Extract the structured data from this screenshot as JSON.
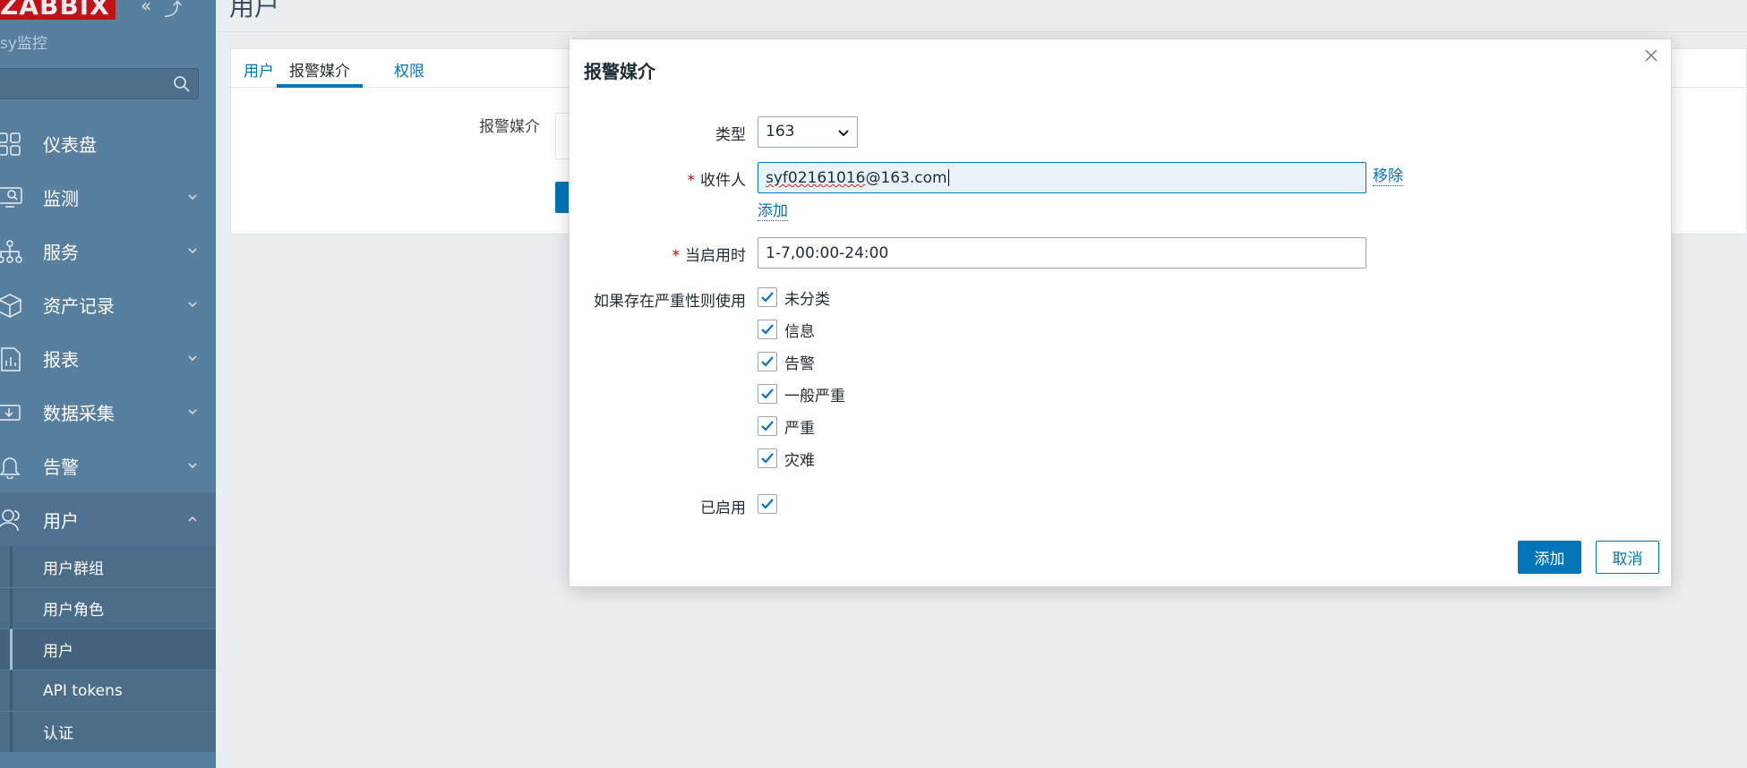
{
  "sidebar": {
    "logo": "ZABBIX",
    "brand_sub": "sy监控",
    "nav": [
      {
        "label": "仪表盘",
        "icon": "dashboard-icon"
      },
      {
        "label": "监测",
        "icon": "monitoring-icon"
      },
      {
        "label": "服务",
        "icon": "services-icon"
      },
      {
        "label": "资产记录",
        "icon": "inventory-icon"
      },
      {
        "label": "报表",
        "icon": "reports-icon"
      },
      {
        "label": "数据采集",
        "icon": "data-collection-icon"
      },
      {
        "label": "告警",
        "icon": "alerts-icon"
      },
      {
        "label": "用户",
        "icon": "users-icon"
      }
    ],
    "subnav": [
      {
        "label": "用户群组"
      },
      {
        "label": "用户角色"
      },
      {
        "label": "用户"
      },
      {
        "label": "API tokens"
      },
      {
        "label": "认证"
      }
    ]
  },
  "page": {
    "title": "用户",
    "tabs": [
      "用户",
      "报警媒介",
      "权限"
    ],
    "media_label": "报警媒介"
  },
  "modal": {
    "title": "报警媒介",
    "type_label": "类型",
    "type_value": "163",
    "sendto_label": "收件人",
    "sendto_value_prefix": "syf02161016",
    "sendto_value_suffix": "@163.com",
    "remove_label": "移除",
    "add_link": "添加",
    "when_label": "当启用时",
    "when_value": "1-7,00:00-24:00",
    "severity_label": "如果存在严重性则使用",
    "severities": [
      "未分类",
      "信息",
      "告警",
      "一般严重",
      "严重",
      "灾难"
    ],
    "enabled_label": "已启用",
    "add_button": "添加",
    "cancel_button": "取消"
  },
  "colors": {
    "accent": "#0275b8",
    "sidebar": "#597f9e",
    "required": "#d40000"
  }
}
